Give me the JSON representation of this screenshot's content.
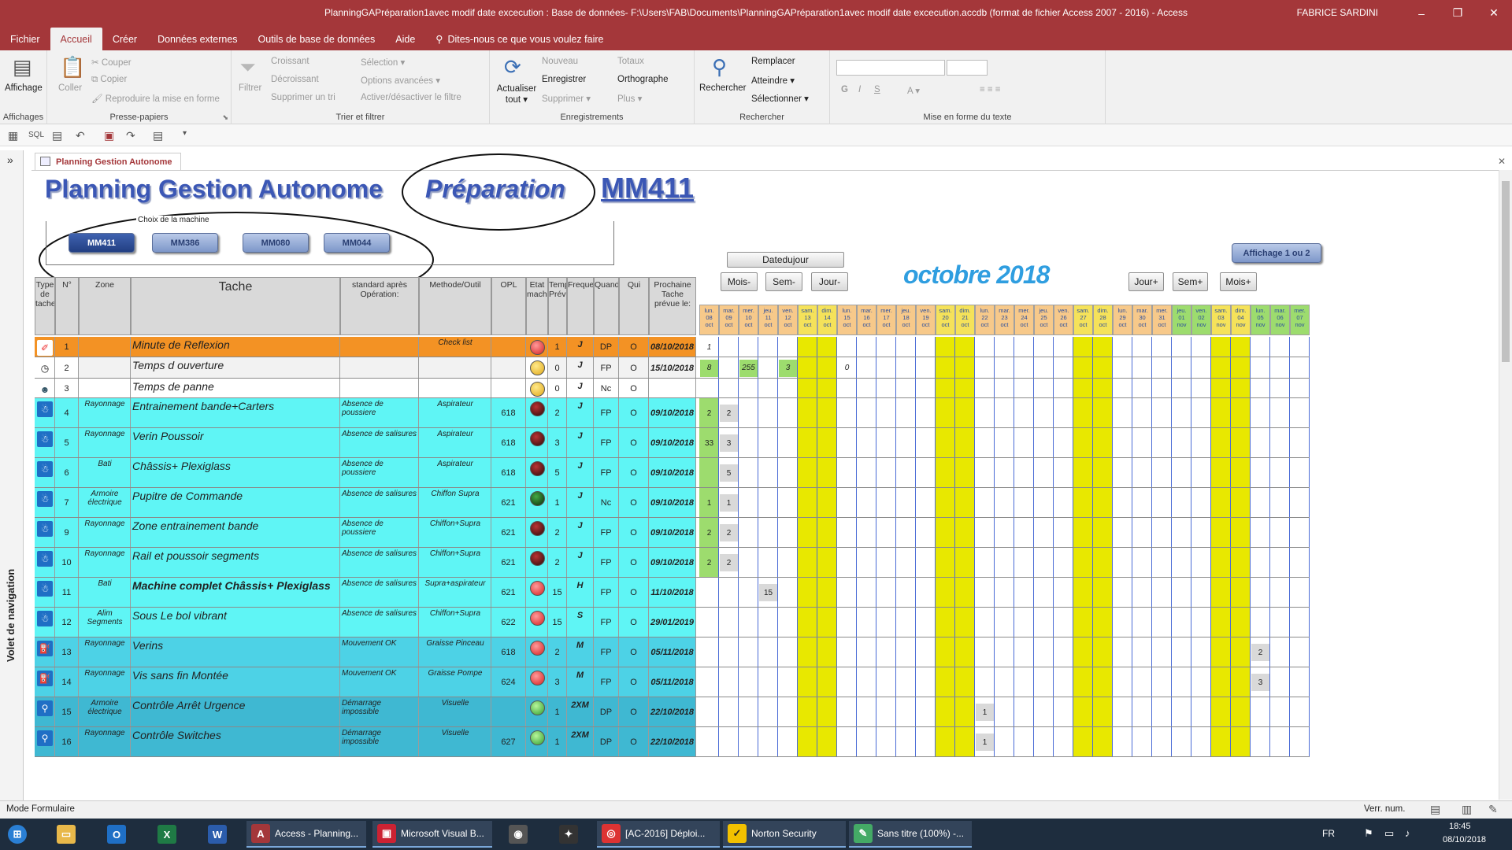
{
  "window": {
    "title": "PlanningGAPréparation1avec modif date excecution : Base de données- F:\\Users\\FAB\\Documents\\PlanningGAPréparation1avec modif date excecution.accdb (format de fichier Access 2007 - 2016)  -  Access",
    "user": "FABRICE SARDINI",
    "minimize": "–",
    "restore": "❐",
    "close": "✕"
  },
  "ribbon_tabs": [
    "Fichier",
    "Accueil",
    "Créer",
    "Données externes",
    "Outils de base de données",
    "Aide"
  ],
  "tellme": "Dites-nous ce que vous voulez faire",
  "ribbon": {
    "affichage": "Affichage",
    "affichages_label": "Affichages",
    "coller": "Coller",
    "couper": "Couper",
    "copier": "Copier",
    "reproduire": "Reproduire la mise en forme",
    "presse_label": "Presse-papiers",
    "filtrer": "Filtrer",
    "croissant": "Croissant",
    "decroissant": "Décroissant",
    "supprimer_tri": "Supprimer un tri",
    "selection": "Sélection ▾",
    "options_avancees": "Options avancées ▾",
    "activer_filtre": "Activer/désactiver le filtre",
    "trier_label": "Trier et filtrer",
    "actualiser": "Actualiser tout ▾",
    "nouveau": "Nouveau",
    "enregistrer": "Enregistrer",
    "supprimer": "Supprimer ▾",
    "totaux": "Totaux",
    "orthographe": "Orthographe",
    "plus": "Plus ▾",
    "enreg_label": "Enregistrements",
    "rechercher": "Rechercher",
    "remplacer": "Remplacer",
    "atteindre": "Atteindre ▾",
    "selectionner": "Sélectionner ▾",
    "rech_label": "Rechercher",
    "mef_label": "Mise en forme du texte",
    "bold": "G",
    "italic": "I",
    "underline": "S"
  },
  "doc_tab": "Planning Gestion Autonome",
  "nav_pane": "Volet de navigation",
  "form": {
    "title": "Planning Gestion Autonome",
    "subtitle": "Préparation",
    "machine": "MM411",
    "machine_choice_label": "Choix de la machine",
    "machines": [
      "MM411",
      "MM386",
      "MM080",
      "MM044"
    ],
    "affichage_btn": "Affichage 1 ou 2",
    "datedujour_btn": "Datedujour",
    "month_title": "octobre 2018",
    "nav_buttons": [
      "Mois-",
      "Sem-",
      "Jour-",
      "Jour+",
      "Sem+",
      "Mois+"
    ]
  },
  "columns": [
    "Type de tache",
    "N°",
    "Zone",
    "Tache",
    "standard après Opération:",
    "Methode/Outil",
    "OPL",
    "Etat machine",
    "Temps Prévu",
    "Frequence",
    "Quand",
    "Qui",
    "Prochaine Tache prévue le:"
  ],
  "days": [
    {
      "d": "lun.",
      "n": "08",
      "m": "oct",
      "c": "g"
    },
    {
      "d": "mar.",
      "n": "09",
      "m": "oct",
      "c": "n"
    },
    {
      "d": "mer.",
      "n": "10",
      "m": "oct",
      "c": "n"
    },
    {
      "d": "jeu.",
      "n": "11",
      "m": "oct",
      "c": "n"
    },
    {
      "d": "ven.",
      "n": "12",
      "m": "oct",
      "c": "n"
    },
    {
      "d": "sam.",
      "n": "13",
      "m": "oct",
      "c": "y"
    },
    {
      "d": "dim.",
      "n": "14",
      "m": "oct",
      "c": "y"
    },
    {
      "d": "lun.",
      "n": "15",
      "m": "oct",
      "c": "n"
    },
    {
      "d": "mar.",
      "n": "16",
      "m": "oct",
      "c": "n"
    },
    {
      "d": "mer.",
      "n": "17",
      "m": "oct",
      "c": "n"
    },
    {
      "d": "jeu.",
      "n": "18",
      "m": "oct",
      "c": "n"
    },
    {
      "d": "ven.",
      "n": "19",
      "m": "oct",
      "c": "n"
    },
    {
      "d": "sam.",
      "n": "20",
      "m": "oct",
      "c": "y"
    },
    {
      "d": "dim.",
      "n": "21",
      "m": "oct",
      "c": "y"
    },
    {
      "d": "lun.",
      "n": "22",
      "m": "oct",
      "c": "n"
    },
    {
      "d": "mar.",
      "n": "23",
      "m": "oct",
      "c": "n"
    },
    {
      "d": "mer.",
      "n": "24",
      "m": "oct",
      "c": "n"
    },
    {
      "d": "jeu.",
      "n": "25",
      "m": "oct",
      "c": "n"
    },
    {
      "d": "ven.",
      "n": "26",
      "m": "oct",
      "c": "n"
    },
    {
      "d": "sam.",
      "n": "27",
      "m": "oct",
      "c": "y"
    },
    {
      "d": "dim.",
      "n": "28",
      "m": "oct",
      "c": "y"
    },
    {
      "d": "lun.",
      "n": "29",
      "m": "oct",
      "c": "n"
    },
    {
      "d": "mar.",
      "n": "30",
      "m": "oct",
      "c": "n"
    },
    {
      "d": "mer.",
      "n": "31",
      "m": "oct",
      "c": "n"
    },
    {
      "d": "jeu.",
      "n": "01",
      "m": "nov",
      "c": "gr"
    },
    {
      "d": "ven.",
      "n": "02",
      "m": "nov",
      "c": "gr"
    },
    {
      "d": "sam.",
      "n": "03",
      "m": "nov",
      "c": "y"
    },
    {
      "d": "dim.",
      "n": "04",
      "m": "nov",
      "c": "y"
    },
    {
      "d": "lun.",
      "n": "05",
      "m": "nov",
      "c": "gr"
    },
    {
      "d": "mar.",
      "n": "06",
      "m": "nov",
      "c": "gr"
    },
    {
      "d": "mer.",
      "n": "07",
      "m": "nov",
      "c": "gr"
    }
  ],
  "rows": [
    {
      "type": "gd",
      "num": "1",
      "zone": "",
      "tache": "Minute de Reflexion",
      "standard": "",
      "methode": "Check list",
      "opl": "",
      "etat": "red",
      "temps": "1",
      "freq": "J",
      "quand": "DP",
      "qui": "O",
      "prochaine": "08/10/2018",
      "bg": "orange",
      "vals": {
        "0": "1"
      }
    },
    {
      "type": "clock",
      "num": "2",
      "zone": "",
      "tache": "Temps d ouverture",
      "standard": "",
      "methode": "",
      "opl": "",
      "etat": "yellow",
      "temps": "0",
      "freq": "J",
      "quand": "FP",
      "qui": "O",
      "prochaine": "15/10/2018",
      "bg": "grey",
      "vals": {
        "0": "8",
        "2": "255",
        "4": "3",
        "7": "0"
      }
    },
    {
      "type": "person",
      "num": "3",
      "zone": "",
      "tache": "Temps de panne",
      "standard": "",
      "methode": "",
      "opl": "",
      "etat": "yellow",
      "temps": "0",
      "freq": "J",
      "quand": "Nc",
      "qui": "O",
      "prochaine": "",
      "bg": "white",
      "vals": {}
    },
    {
      "type": "clean",
      "num": "4",
      "zone": "Rayonnage",
      "tache": "Entrainement bande+Carters",
      "standard": "Absence de poussiere",
      "methode": "Aspirateur",
      "opl": "618",
      "etat": "darkred",
      "temps": "2",
      "freq": "J",
      "quand": "FP",
      "qui": "O",
      "prochaine": "09/10/2018",
      "bg": "cyan",
      "vals": {
        "0": "2",
        "1": "2"
      }
    },
    {
      "type": "clean",
      "num": "5",
      "zone": "Rayonnage",
      "tache": "Verin Poussoir",
      "standard": "Absence de salisures",
      "methode": "Aspirateur",
      "opl": "618",
      "etat": "darkred",
      "temps": "3",
      "freq": "J",
      "quand": "FP",
      "qui": "O",
      "prochaine": "09/10/2018",
      "bg": "cyan",
      "vals": {
        "0": "33",
        "1": "3"
      }
    },
    {
      "type": "clean",
      "num": "6",
      "zone": "Bati",
      "tache": "Châssis+ Plexiglass",
      "standard": "Absence de poussiere",
      "methode": "Aspirateur",
      "opl": "618",
      "etat": "darkred",
      "temps": "5",
      "freq": "J",
      "quand": "FP",
      "qui": "O",
      "prochaine": "09/10/2018",
      "bg": "cyan",
      "vals": {
        "1": "5"
      }
    },
    {
      "type": "clean",
      "num": "7",
      "zone": "Armoire électrique",
      "tache": "Pupitre de Commande",
      "standard": "Absence de salisures",
      "methode": "Chiffon Supra",
      "opl": "621",
      "etat": "darkgreen",
      "temps": "1",
      "freq": "J",
      "quand": "Nc",
      "qui": "O",
      "prochaine": "09/10/2018",
      "bg": "cyan",
      "vals": {
        "0": "1",
        "1": "1"
      }
    },
    {
      "type": "clean",
      "num": "9",
      "zone": "Rayonnage",
      "tache": "Zone entrainement bande",
      "standard": "Absence de poussiere",
      "methode": "Chiffon+Supra",
      "opl": "621",
      "etat": "darkred",
      "temps": "2",
      "freq": "J",
      "quand": "FP",
      "qui": "O",
      "prochaine": "09/10/2018",
      "bg": "cyan",
      "vals": {
        "0": "2",
        "1": "2"
      }
    },
    {
      "type": "clean",
      "num": "10",
      "zone": "Rayonnage",
      "tache": "Rail et poussoir segments",
      "standard": "Absence de salisures",
      "methode": "Chiffon+Supra",
      "opl": "621",
      "etat": "darkred",
      "temps": "2",
      "freq": "J",
      "quand": "FP",
      "qui": "O",
      "prochaine": "09/10/2018",
      "bg": "cyan",
      "vals": {
        "0": "2",
        "1": "2"
      }
    },
    {
      "type": "clean",
      "num": "11",
      "zone": "Bati",
      "tache": "Machine complet Châssis+ Plexiglass",
      "standard": "Absence de salisures",
      "methode": "Supra+aspirateur",
      "opl": "621",
      "etat": "red",
      "temps": "15",
      "freq": "H",
      "quand": "FP",
      "qui": "O",
      "prochaine": "11/10/2018",
      "bg": "cyan",
      "vals": {
        "3": "15"
      }
    },
    {
      "type": "clean",
      "num": "12",
      "zone": "Alim Segments",
      "tache": "Sous Le bol vibrant",
      "standard": "Absence de salisures",
      "methode": "Chiffon+Supra",
      "opl": "622",
      "etat": "red",
      "temps": "15",
      "freq": "S",
      "quand": "FP",
      "qui": "O",
      "prochaine": "29/01/2019",
      "bg": "cyan",
      "vals": {}
    },
    {
      "type": "oil",
      "num": "13",
      "zone": "Rayonnage",
      "tache": "Verins",
      "standard": "Mouvement OK",
      "methode": "Graisse Pinceau",
      "opl": "618",
      "etat": "red",
      "temps": "2",
      "freq": "M",
      "quand": "FP",
      "qui": "O",
      "prochaine": "05/11/2018",
      "bg": "teal",
      "vals": {
        "28": "2"
      }
    },
    {
      "type": "oil",
      "num": "14",
      "zone": "Rayonnage",
      "tache": "Vis sans fin Montée",
      "standard": "Mouvement OK",
      "methode": "Graisse Pompe",
      "opl": "624",
      "etat": "red",
      "temps": "3",
      "freq": "M",
      "quand": "FP",
      "qui": "O",
      "prochaine": "05/11/2018",
      "bg": "teal",
      "vals": {
        "28": "3"
      }
    },
    {
      "type": "search",
      "num": "15",
      "zone": "Armoire électrique",
      "tache": "Contrôle Arrêt Urgence",
      "standard": "Démarrage impossible",
      "methode": "Visuelle",
      "opl": "",
      "etat": "green",
      "temps": "1",
      "freq": "2XM",
      "quand": "DP",
      "qui": "O",
      "prochaine": "22/10/2018",
      "bg": "blue",
      "vals": {
        "14": "1"
      }
    },
    {
      "type": "search",
      "num": "16",
      "zone": "Rayonnage",
      "tache": "Contrôle Switches",
      "standard": "Démarrage impossible",
      "methode": "Visuelle",
      "opl": "627",
      "etat": "green",
      "temps": "1",
      "freq": "2XM",
      "quand": "DP",
      "qui": "O",
      "prochaine": "22/10/2018",
      "bg": "blue",
      "vals": {
        "14": "1"
      }
    }
  ],
  "status": {
    "mode": "Mode Formulaire",
    "verr": "Verr. num."
  },
  "taskbar": {
    "items": [
      "Access - Planning...",
      "Microsoft Visual B...",
      "[AC-2016] Déploi...",
      "Norton Security",
      "Sans titre (100%) -..."
    ],
    "lang": "FR",
    "time": "18:45",
    "date": "08/10/2018"
  },
  "colors": {
    "accent": "#a4373a",
    "title_blue": "#3b57b5",
    "month_blue": "#2f9ee0",
    "cyan_row": "#5ff5f5",
    "teal_row": "#4dd2e6",
    "blue_row": "#3fb8d2",
    "orange_row": "#f39224",
    "weekend": "#e8e800",
    "today": "#9ddc6e"
  }
}
